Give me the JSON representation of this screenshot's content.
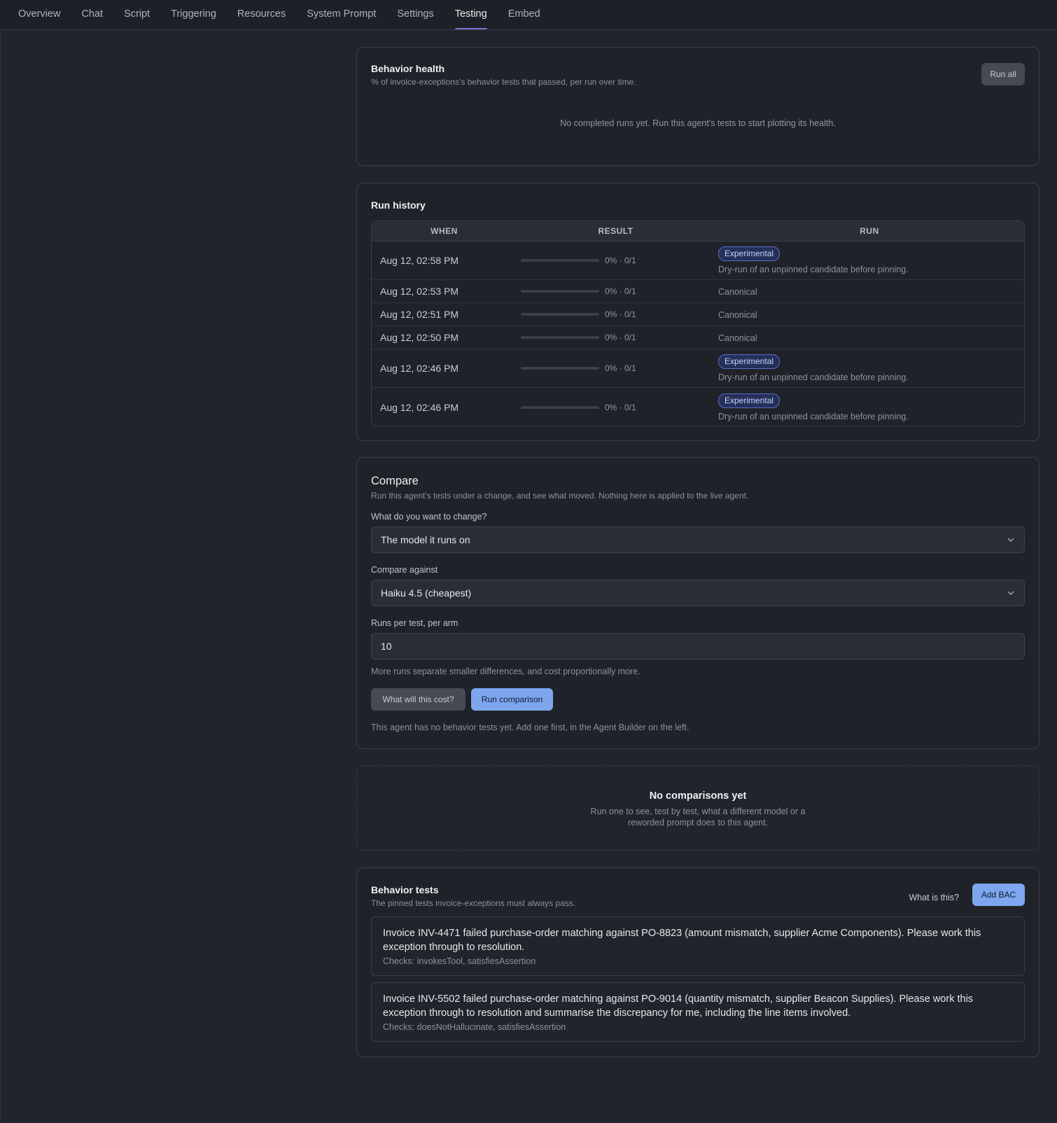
{
  "nav": {
    "tabs": [
      "Overview",
      "Chat",
      "Script",
      "Triggering",
      "Resources",
      "System Prompt",
      "Settings",
      "Testing",
      "Embed"
    ],
    "active": "Testing"
  },
  "health": {
    "title": "Behavior health",
    "subtitle": "% of invoice-exceptions's behavior tests that passed, per run over time.",
    "run_all_label": "Run all",
    "empty_text": "No completed runs yet. Run this agent's tests to start plotting its health."
  },
  "history": {
    "title": "Run history",
    "columns": [
      "WHEN",
      "RESULT",
      "RUN"
    ],
    "rows": [
      {
        "when": "Aug 12, 02:58 PM",
        "pass_fraction": 0,
        "result": "0% · 0/1",
        "run_type": "Experimental",
        "run_desc": "Dry-run of an unpinned candidate before pinning."
      },
      {
        "when": "Aug 12, 02:53 PM",
        "pass_fraction": 0,
        "result": "0% · 0/1",
        "run_type": "Canonical",
        "run_desc": ""
      },
      {
        "when": "Aug 12, 02:51 PM",
        "pass_fraction": 0,
        "result": "0% · 0/1",
        "run_type": "Canonical",
        "run_desc": ""
      },
      {
        "when": "Aug 12, 02:50 PM",
        "pass_fraction": 0,
        "result": "0% · 0/1",
        "run_type": "Canonical",
        "run_desc": ""
      },
      {
        "when": "Aug 12, 02:46 PM",
        "pass_fraction": 0,
        "result": "0% · 0/1",
        "run_type": "Experimental",
        "run_desc": "Dry-run of an unpinned candidate before pinning."
      },
      {
        "when": "Aug 12, 02:46 PM",
        "pass_fraction": 0,
        "result": "0% · 0/1",
        "run_type": "Experimental",
        "run_desc": "Dry-run of an unpinned candidate before pinning."
      }
    ]
  },
  "compare": {
    "title": "Compare",
    "subtitle": "Run this agent's tests under a change, and see what moved. Nothing here is applied to the live agent.",
    "change_label": "What do you want to change?",
    "change_value": "The model it runs on",
    "against_label": "Compare against",
    "against_value": "Haiku 4.5 (cheapest)",
    "runs_label": "Runs per test, per arm",
    "runs_value": "10",
    "runs_help": "More runs separate smaller differences, and cost proportionally more.",
    "cost_button": "What will this cost?",
    "run_button": "Run comparison",
    "notice": "This agent has no behavior tests yet. Add one first, in the Agent Builder on the left."
  },
  "no_comparisons": {
    "title": "No comparisons yet",
    "text": "Run one to see, test by test, what a different model or a reworded prompt does to this agent."
  },
  "tests": {
    "title": "Behavior tests",
    "subtitle": "The pinned tests invoice-exceptions must always pass.",
    "what_is_this": "What is this?",
    "add_button": "Add BAC",
    "items": [
      {
        "text": "Invoice INV-4471 failed purchase-order matching against PO-8823 (amount mismatch, supplier Acme Components). Please work this exception through to resolution.",
        "checks": "Checks: invokesTool, satisfiesAssertion"
      },
      {
        "text": "Invoice INV-5502 failed purchase-order matching against PO-9014 (quantity mismatch, supplier Beacon Supplies). Please work this exception through to resolution and summarise the discrepancy for me, including the line items involved.",
        "checks": "Checks: doesNotHallucinate, satisfiesAssertion"
      }
    ]
  },
  "colors": {
    "accent_blue": "#7ea6ef",
    "tab_underline": "#7f6fd9",
    "badge_border": "#5b6ec9"
  }
}
